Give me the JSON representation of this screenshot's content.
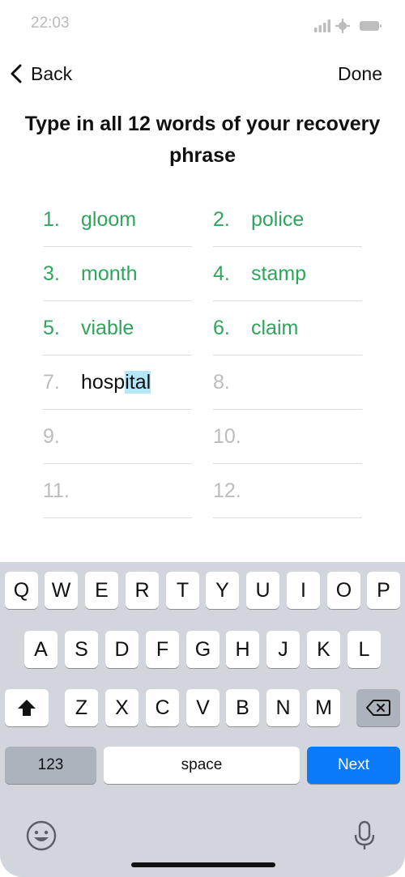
{
  "status_bar": {
    "time": "22:03"
  },
  "nav": {
    "back_label": "Back",
    "done_label": "Done"
  },
  "title": "Type in all 12 words of your recovery phrase",
  "words": [
    {
      "num": "1.",
      "word": "gloom",
      "state": "done"
    },
    {
      "num": "2.",
      "word": "police",
      "state": "done"
    },
    {
      "num": "3.",
      "word": "month",
      "state": "done"
    },
    {
      "num": "4.",
      "word": "stamp",
      "state": "done"
    },
    {
      "num": "5.",
      "word": "viable",
      "state": "done"
    },
    {
      "num": "6.",
      "word": "claim",
      "state": "done"
    },
    {
      "num": "7.",
      "word_typed": "hosp",
      "word_suggested": "ital",
      "state": "active"
    },
    {
      "num": "8.",
      "word": "",
      "state": "empty"
    },
    {
      "num": "9.",
      "word": "",
      "state": "empty"
    },
    {
      "num": "10.",
      "word": "",
      "state": "empty"
    },
    {
      "num": "11.",
      "word": "",
      "state": "empty"
    },
    {
      "num": "12.",
      "word": "",
      "state": "empty"
    }
  ],
  "keyboard": {
    "row1": [
      "Q",
      "W",
      "E",
      "R",
      "T",
      "Y",
      "U",
      "I",
      "O",
      "P"
    ],
    "row2": [
      "A",
      "S",
      "D",
      "F",
      "G",
      "H",
      "J",
      "K",
      "L"
    ],
    "row3": [
      "Z",
      "X",
      "C",
      "V",
      "B",
      "N",
      "M"
    ],
    "numbers_label": "123",
    "space_label": "space",
    "next_label": "Next",
    "icons": {
      "shift": "shift-icon",
      "backspace": "backspace-icon",
      "emoji": "emoji-icon",
      "mic": "microphone-icon"
    }
  },
  "colors": {
    "done_word": "#2fa55b",
    "placeholder": "#bcbcbc",
    "selection": "#b3e7f8",
    "next_key": "#0b7af8",
    "keyboard_bg": "#d2d5dc"
  }
}
